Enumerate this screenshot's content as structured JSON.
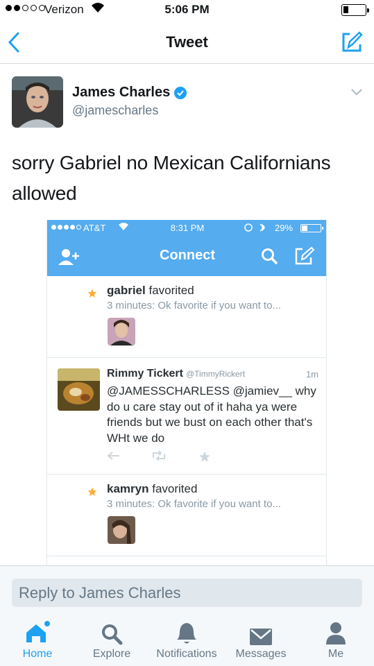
{
  "status_bar": {
    "carrier": "Verizon",
    "time": "5:06 PM"
  },
  "nav": {
    "title": "Tweet"
  },
  "tweet": {
    "author_name": "James Charles",
    "author_handle": "@jamescharles",
    "text": "sorry Gabriel no Mexican Californians allowed"
  },
  "embedded": {
    "status": {
      "carrier": "AT&T",
      "time": "8:31 PM",
      "battery": "29%"
    },
    "title": "Connect",
    "notifications": [
      {
        "user": "gabriel",
        "action": "favorited",
        "detail": "3 minutes: Ok favorite if you want to..."
      },
      {
        "user": "kamryn",
        "action": "favorited",
        "detail": "3 minutes: Ok favorite if you want to..."
      }
    ],
    "reply_tweet": {
      "name": "Rimmy Tickert",
      "handle": "@TimmyRickert",
      "time": "1m",
      "text": "@JAMESSCHARLESS @jamiev__ why do u care stay out of it haha ya were friends but we bust on each other that's WHt we do"
    }
  },
  "reply": {
    "placeholder": "Reply to James Charles"
  },
  "tabs": [
    {
      "label": "Home",
      "icon": "home-icon",
      "active": true
    },
    {
      "label": "Explore",
      "icon": "search-icon"
    },
    {
      "label": "Notifications",
      "icon": "bell-icon"
    },
    {
      "label": "Messages",
      "icon": "envelope-icon"
    },
    {
      "label": "Me",
      "icon": "person-icon"
    }
  ],
  "colors": {
    "accent": "#1da1f2",
    "embedded_header": "#55acee",
    "star": "#ffac33"
  }
}
